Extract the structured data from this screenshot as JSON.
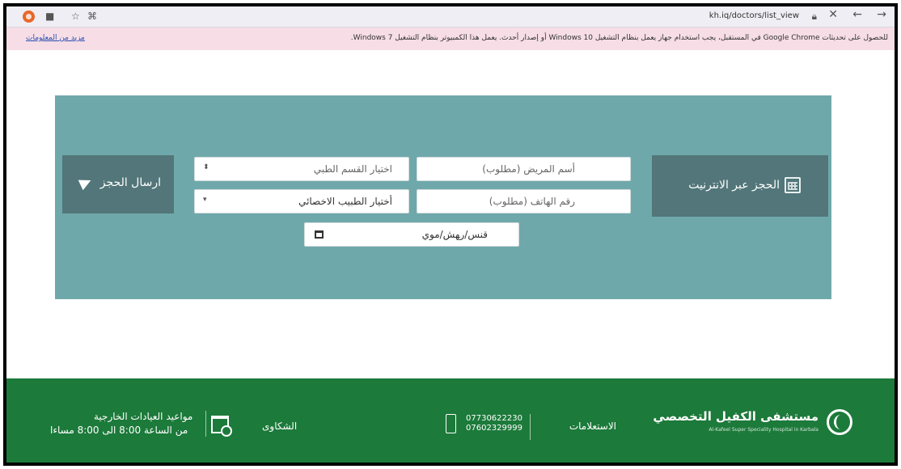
{
  "browser": {
    "url": "kh.iq/doctors/list_view"
  },
  "infobar": {
    "message": "للحصول على تحديثات Google Chrome في المستقبل، يجب استخدام جهاز يعمل بنظام التشغيل Windows 10 أو إصدار أحدث. يعمل هذا الكمبيوتر بنظام التشغيل Windows 7.",
    "more_link": "مزيد من المعلومات"
  },
  "booking": {
    "online_label": "الحجز عبر الانترنيت",
    "send_label": "ارسال الحجز",
    "patient_name_placeholder": "أسم المريض (مطلوب)",
    "phone_placeholder": "رقم الهاتف   (مطلوب)",
    "department_select": "اختيار القسم الطبي",
    "doctor_select": "أختيار الطبيب الاخصائي",
    "date_placeholder": "ﻗﻨﺲ/ﺭﻬﺶ/ﻣﻮﻱ"
  },
  "footer": {
    "brand_name": "مستشفى الكفيل التخصصي",
    "brand_sub": "Al-Kafeel Super Speciality Hospital in Karbala",
    "inquiries_label": "الاستعلامات",
    "phone_1": "07730622230",
    "phone_2": "07602329999",
    "complaints_label": "الشكاوى",
    "hours_title": "مواعيد العيادات الخارجية",
    "hours_time": "من الساعة 8:00 الى 8:00 مساءا"
  },
  "colors": {
    "hero": "#6fa8ab",
    "panel": "#527679",
    "footer": "#1c7a3a",
    "infobar": "#f6dde6"
  }
}
